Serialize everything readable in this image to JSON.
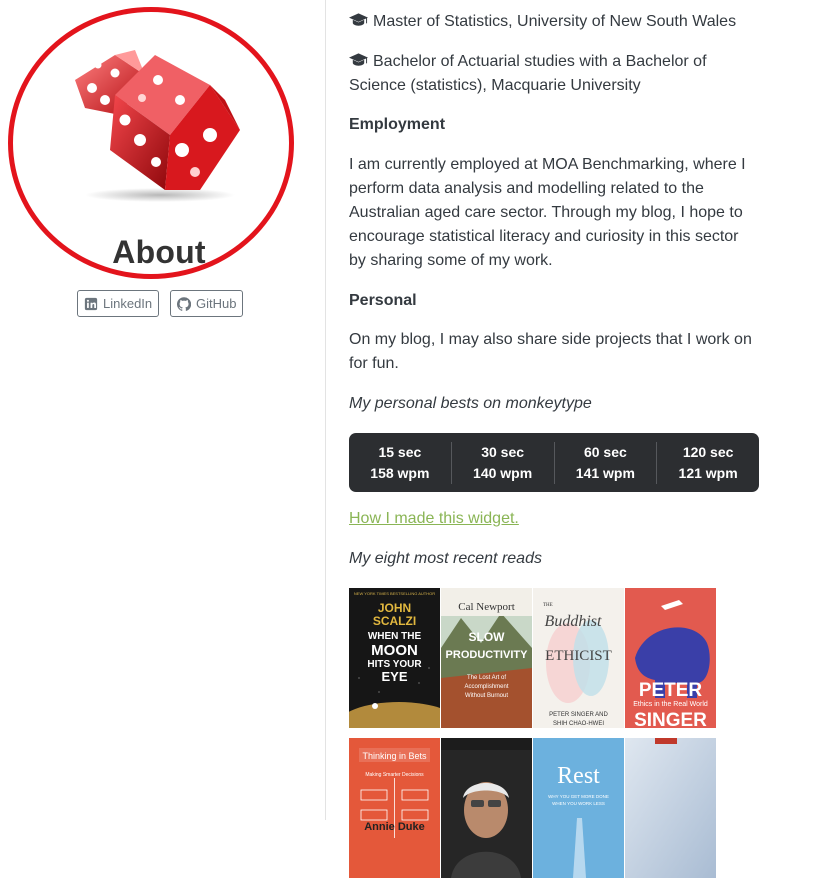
{
  "sidebar": {
    "title": "About",
    "links": [
      {
        "label": "LinkedIn",
        "icon": "linkedin-icon"
      },
      {
        "label": "GitHub",
        "icon": "github-icon"
      }
    ]
  },
  "education": [
    "Master of Statistics, University of New South Wales",
    "Bachelor of Actuarial studies with a Bachelor of Science (statistics), Macquarie University"
  ],
  "employment": {
    "heading": "Employment",
    "text": "I am currently employed at MOA Benchmarking, where I perform data analysis and modelling related to the Australian aged care sector. Through my blog, I hope to encourage statistical literacy and curiosity in this sector by sharing some of my work."
  },
  "personal": {
    "heading": "Personal",
    "text": "On my blog, I may also share side projects that I work on for fun."
  },
  "monkeytype": {
    "caption": "My personal bests on monkeytype",
    "stats": [
      {
        "duration": "15 sec",
        "wpm": "158 wpm"
      },
      {
        "duration": "30 sec",
        "wpm": "140 wpm"
      },
      {
        "duration": "60 sec",
        "wpm": "141 wpm"
      },
      {
        "duration": "120 sec",
        "wpm": "121 wpm"
      }
    ],
    "link_text": "How I made this widget."
  },
  "reads": {
    "caption": "My eight most recent reads",
    "books": [
      {
        "top": "NEW YORK TIMES BESTSELLING AUTHOR",
        "author": "JOHN SCALZI",
        "title": "WHEN THE MOON HITS YOUR EYE",
        "color": "#1b1b1b"
      },
      {
        "author": "Cal Newport",
        "title": "SLOW PRODUCTIVITY",
        "subtitle": "The Lost Art of Accomplishment Without Burnout",
        "color": "#8a5a3c"
      },
      {
        "title": "The Buddhist and the Ethicist",
        "author": "PETER SINGER AND SHIH CHAO-HWEI",
        "color": "#f5f3ef"
      },
      {
        "author": "PETER SINGER",
        "title": "Ethics in the Real World",
        "color": "#e15a4f"
      },
      {
        "title": "Thinking in Bets",
        "subtitle": "Making Smarter Decisions",
        "author": "Annie Duke",
        "color": "#e6593a"
      },
      {
        "title": "",
        "color": "#2a2a2a"
      },
      {
        "title": "Rest",
        "subtitle": "WHY YOU GET MORE DONE WHEN YOU WORK LESS",
        "color": "#6fb3e0"
      },
      {
        "title": "",
        "color": "#c9d6e6"
      }
    ]
  }
}
